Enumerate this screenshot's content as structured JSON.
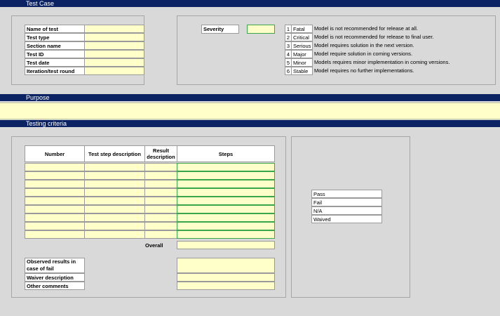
{
  "sections": {
    "test_case": "Test Case",
    "purpose": "Purpose",
    "testing_criteria": "Testing criteria"
  },
  "test_case_fields": [
    "Name of test",
    "Test type",
    "Section name",
    "Test ID",
    "Test date",
    "Iteration/test round"
  ],
  "severity": {
    "label": "Severity",
    "levels": [
      {
        "num": "1",
        "name": "Fatal",
        "desc": "Model is not recommended for release at all."
      },
      {
        "num": "2",
        "name": "Critical",
        "desc": "Model is not recommended for release to final user."
      },
      {
        "num": "3",
        "name": "Serious",
        "desc": "Model requires solution in the next version."
      },
      {
        "num": "4",
        "name": "Major",
        "desc": "Model require solution in coming versions."
      },
      {
        "num": "5",
        "name": "Minor",
        "desc": "Models requires minor implementation in coming versions."
      },
      {
        "num": "6",
        "name": "Stable",
        "desc": "Model requires no further implementations."
      }
    ]
  },
  "criteria_table": {
    "headers": [
      "Number",
      "Test step description",
      "Result description",
      "Steps"
    ],
    "row_count": 9,
    "overall_label": "Overall"
  },
  "bottom_fields": [
    "Observed results in case of fail",
    "Waiver description",
    "Other comments"
  ],
  "result_options": [
    "Pass",
    "Fail",
    "N/A",
    "Waived"
  ],
  "colors": {
    "band": "#0b2363",
    "input": "#ffffc9",
    "accent_green": "#3aa64a"
  }
}
